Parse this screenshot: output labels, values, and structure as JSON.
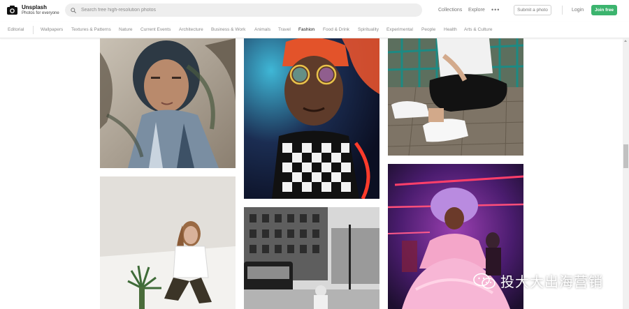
{
  "header": {
    "brand_title": "Unsplash",
    "brand_subtitle": "Photos for everyone",
    "search_placeholder": "Search free high-resolution photos",
    "links": {
      "collections": "Collections",
      "explore": "Explore",
      "more": "•••",
      "submit": "Submit a photo",
      "login": "Login",
      "join": "Join free"
    }
  },
  "nav": {
    "categories": [
      "Editorial",
      "Wallpapers",
      "Textures & Patterns",
      "Nature",
      "Current Events",
      "Architecture",
      "Business & Work",
      "Animals",
      "Travel",
      "Fashion",
      "Food & Drink",
      "Spirituality",
      "Experimental",
      "People",
      "Health",
      "Arts & Culture"
    ],
    "active": "Fashion"
  },
  "photos": [
    {
      "name": "photo-woman-headscarf",
      "column": 1
    },
    {
      "name": "photo-woman-white-shirt",
      "column": 1
    },
    {
      "name": "photo-man-neon-glasses",
      "column": 2
    },
    {
      "name": "photo-city-street",
      "column": 2
    },
    {
      "name": "photo-sitting-sneakers",
      "column": 3
    },
    {
      "name": "photo-pink-dress-neon",
      "column": 3
    }
  ],
  "watermark": {
    "text": "投大大出海营销"
  },
  "colors": {
    "join_green": "#3cb46e",
    "search_bg": "#eeeeee",
    "nav_text": "#8a8a8a"
  }
}
